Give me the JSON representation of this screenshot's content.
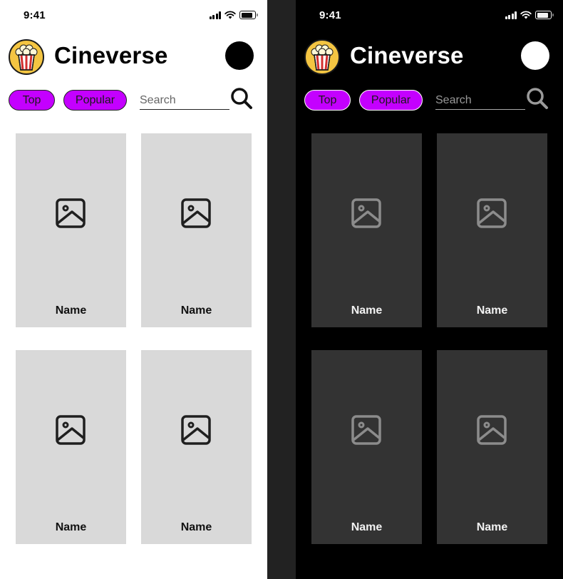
{
  "colors": {
    "accent": "#c400ff",
    "light_background": "#ffffff",
    "dark_background": "#000000",
    "light_card": "#d9d9d9",
    "dark_card": "#333333",
    "gutter": "#222222"
  },
  "screens": [
    {
      "theme": "light",
      "status_time": "9:41",
      "app_title": "Cineverse",
      "logo_icon": "popcorn-icon",
      "filters": [
        "Top",
        "Popular"
      ],
      "search": {
        "placeholder": "Search",
        "icon": "search-icon"
      },
      "cards": [
        {
          "name": "Name",
          "icon": "image-placeholder-icon"
        },
        {
          "name": "Name",
          "icon": "image-placeholder-icon"
        },
        {
          "name": "Name",
          "icon": "image-placeholder-icon"
        },
        {
          "name": "Name",
          "icon": "image-placeholder-icon"
        }
      ]
    },
    {
      "theme": "dark",
      "status_time": "9:41",
      "app_title": "Cineverse",
      "logo_icon": "popcorn-icon",
      "filters": [
        "Top",
        "Popular"
      ],
      "search": {
        "placeholder": "Search",
        "icon": "search-icon"
      },
      "cards": [
        {
          "name": "Name",
          "icon": "image-placeholder-icon"
        },
        {
          "name": "Name",
          "icon": "image-placeholder-icon"
        },
        {
          "name": "Name",
          "icon": "image-placeholder-icon"
        },
        {
          "name": "Name",
          "icon": "image-placeholder-icon"
        }
      ]
    }
  ]
}
